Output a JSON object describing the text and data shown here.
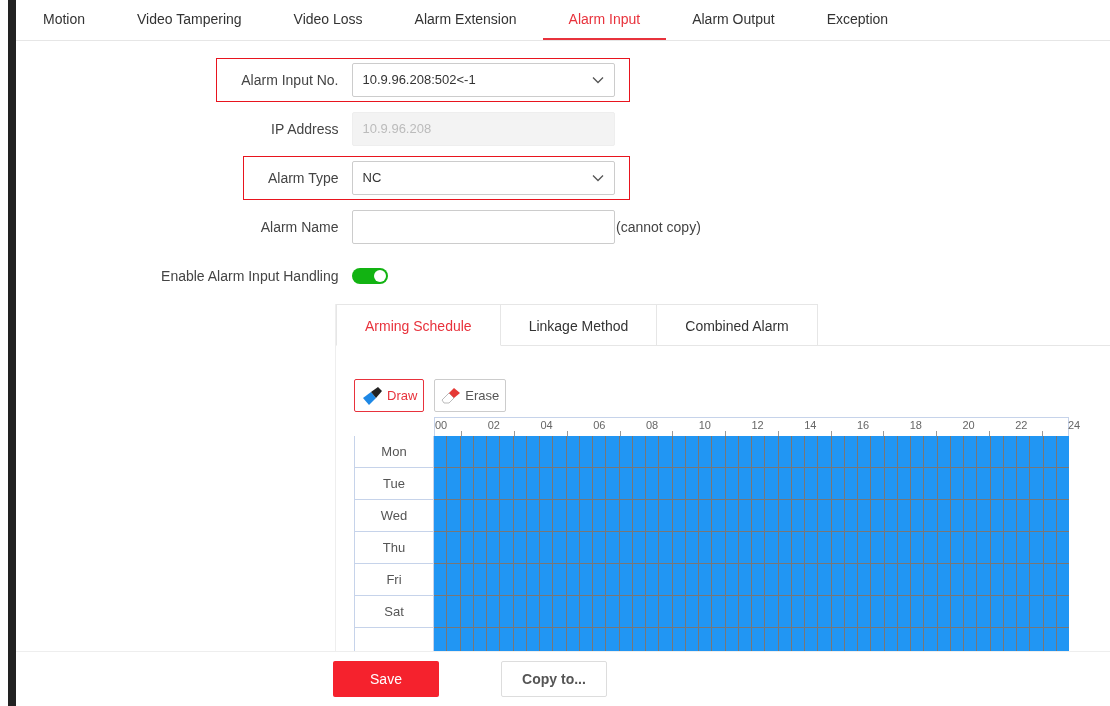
{
  "tabs": [
    {
      "label": "Motion",
      "selected": false
    },
    {
      "label": "Video Tampering",
      "selected": false
    },
    {
      "label": "Video Loss",
      "selected": false
    },
    {
      "label": "Alarm Extension",
      "selected": false
    },
    {
      "label": "Alarm Input",
      "selected": true
    },
    {
      "label": "Alarm Output",
      "selected": false
    },
    {
      "label": "Exception",
      "selected": false
    }
  ],
  "form": [
    {
      "kind": "select",
      "label": "Alarm Input No.",
      "value": "10.9.96.208:502<-1",
      "highlighted": true
    },
    {
      "kind": "readonly",
      "label": "IP Address",
      "value": "10.9.96.208",
      "highlighted": false
    },
    {
      "kind": "select",
      "label": "Alarm Type",
      "value": "NC",
      "highlighted": true
    },
    {
      "kind": "text",
      "label": "Alarm Name",
      "note": "(cannot copy)",
      "highlighted": false
    },
    {
      "kind": "toggle",
      "label": "Enable Alarm Input Handling",
      "on": true,
      "highlighted": false
    }
  ],
  "sub_tabs": [
    {
      "label": "Arming Schedule",
      "selected": true
    },
    {
      "label": "Linkage Method",
      "selected": false
    },
    {
      "label": "Combined Alarm",
      "selected": false
    }
  ],
  "tools": [
    {
      "kind": "draw",
      "label": "Draw",
      "selected": true
    },
    {
      "kind": "erase",
      "label": "Erase",
      "selected": false
    }
  ],
  "hours": [
    "00",
    "02",
    "04",
    "06",
    "08",
    "10",
    "12",
    "14",
    "16",
    "18",
    "20",
    "22",
    "24"
  ],
  "days": [
    {
      "label": "Mon",
      "armed": true
    },
    {
      "label": "Tue",
      "armed": true
    },
    {
      "label": "Wed",
      "armed": true
    },
    {
      "label": "Thu",
      "armed": true
    },
    {
      "label": "Fri",
      "armed": true
    },
    {
      "label": "Sat",
      "armed": true
    },
    {
      "armed": true
    }
  ],
  "buttons": [
    {
      "kind": "primary",
      "label": "Save"
    },
    {
      "kind": "secondary",
      "label": "Copy to..."
    }
  ]
}
